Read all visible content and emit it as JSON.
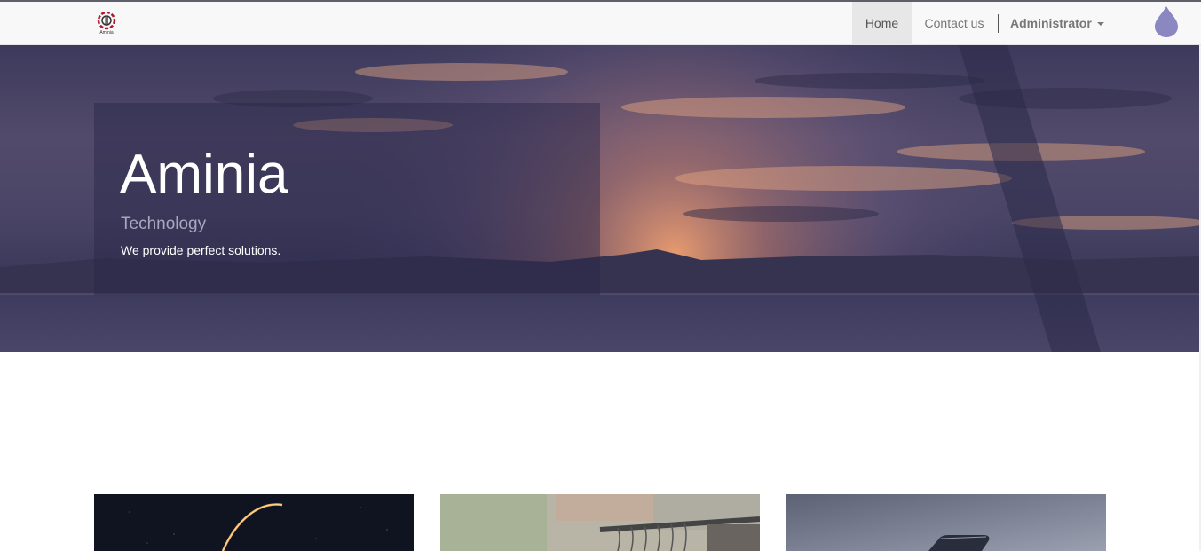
{
  "navbar": {
    "logo_text": "Aminia",
    "items": [
      {
        "label": "Home",
        "active": true
      },
      {
        "label": "Contact us",
        "active": false
      }
    ],
    "user_menu_label": "Administrator"
  },
  "hero": {
    "title": "Aminia",
    "subtitle": "Technology",
    "tagline": "We provide perfect solutions."
  },
  "cards": [
    {
      "image": "space-orbit-image"
    },
    {
      "image": "clothes-rack-image"
    },
    {
      "image": "smartphone-image"
    }
  ],
  "colors": {
    "navbar_bg": "#f8f8f8",
    "hero_overlay": "#282646",
    "accent_drop": "#8b87c0"
  }
}
